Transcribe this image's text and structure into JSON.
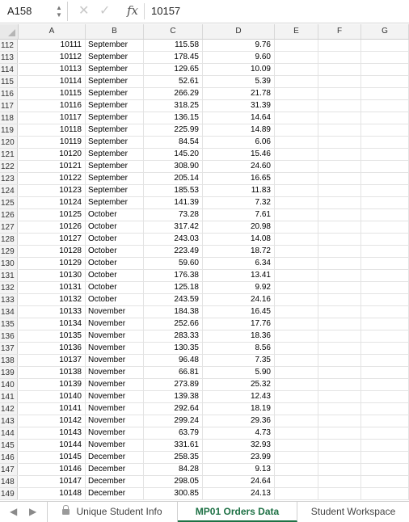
{
  "formula_bar": {
    "name_box": "A158",
    "cancel_icon": "close-icon",
    "enter_icon": "checkmark-icon",
    "fx_label": "fx",
    "value": "10157"
  },
  "columns": [
    "A",
    "B",
    "C",
    "D",
    "E",
    "F",
    "G"
  ],
  "rows": [
    {
      "n": "112",
      "a": "10111",
      "b": "September",
      "c": "115.58",
      "d": "9.76"
    },
    {
      "n": "113",
      "a": "10112",
      "b": "September",
      "c": "178.45",
      "d": "9.60"
    },
    {
      "n": "114",
      "a": "10113",
      "b": "September",
      "c": "129.65",
      "d": "10.09"
    },
    {
      "n": "115",
      "a": "10114",
      "b": "September",
      "c": "52.61",
      "d": "5.39"
    },
    {
      "n": "116",
      "a": "10115",
      "b": "September",
      "c": "266.29",
      "d": "21.78"
    },
    {
      "n": "117",
      "a": "10116",
      "b": "September",
      "c": "318.25",
      "d": "31.39"
    },
    {
      "n": "118",
      "a": "10117",
      "b": "September",
      "c": "136.15",
      "d": "14.64"
    },
    {
      "n": "119",
      "a": "10118",
      "b": "September",
      "c": "225.99",
      "d": "14.89"
    },
    {
      "n": "120",
      "a": "10119",
      "b": "September",
      "c": "84.54",
      "d": "6.06"
    },
    {
      "n": "121",
      "a": "10120",
      "b": "September",
      "c": "145.20",
      "d": "15.46"
    },
    {
      "n": "122",
      "a": "10121",
      "b": "September",
      "c": "308.90",
      "d": "24.60"
    },
    {
      "n": "123",
      "a": "10122",
      "b": "September",
      "c": "205.14",
      "d": "16.65"
    },
    {
      "n": "124",
      "a": "10123",
      "b": "September",
      "c": "185.53",
      "d": "11.83"
    },
    {
      "n": "125",
      "a": "10124",
      "b": "September",
      "c": "141.39",
      "d": "7.32"
    },
    {
      "n": "126",
      "a": "10125",
      "b": "October",
      "c": "73.28",
      "d": "7.61"
    },
    {
      "n": "127",
      "a": "10126",
      "b": "October",
      "c": "317.42",
      "d": "20.98"
    },
    {
      "n": "128",
      "a": "10127",
      "b": "October",
      "c": "243.03",
      "d": "14.08"
    },
    {
      "n": "129",
      "a": "10128",
      "b": "October",
      "c": "223.49",
      "d": "18.72"
    },
    {
      "n": "130",
      "a": "10129",
      "b": "October",
      "c": "59.60",
      "d": "6.34"
    },
    {
      "n": "131",
      "a": "10130",
      "b": "October",
      "c": "176.38",
      "d": "13.41"
    },
    {
      "n": "132",
      "a": "10131",
      "b": "October",
      "c": "125.18",
      "d": "9.92"
    },
    {
      "n": "133",
      "a": "10132",
      "b": "October",
      "c": "243.59",
      "d": "24.16"
    },
    {
      "n": "134",
      "a": "10133",
      "b": "November",
      "c": "184.38",
      "d": "16.45"
    },
    {
      "n": "135",
      "a": "10134",
      "b": "November",
      "c": "252.66",
      "d": "17.76"
    },
    {
      "n": "136",
      "a": "10135",
      "b": "November",
      "c": "283.33",
      "d": "18.36"
    },
    {
      "n": "137",
      "a": "10136",
      "b": "November",
      "c": "130.35",
      "d": "8.56"
    },
    {
      "n": "138",
      "a": "10137",
      "b": "November",
      "c": "96.48",
      "d": "7.35"
    },
    {
      "n": "139",
      "a": "10138",
      "b": "November",
      "c": "66.81",
      "d": "5.90"
    },
    {
      "n": "140",
      "a": "10139",
      "b": "November",
      "c": "273.89",
      "d": "25.32"
    },
    {
      "n": "141",
      "a": "10140",
      "b": "November",
      "c": "139.38",
      "d": "12.43"
    },
    {
      "n": "142",
      "a": "10141",
      "b": "November",
      "c": "292.64",
      "d": "18.19"
    },
    {
      "n": "143",
      "a": "10142",
      "b": "November",
      "c": "299.24",
      "d": "29.36"
    },
    {
      "n": "144",
      "a": "10143",
      "b": "November",
      "c": "63.79",
      "d": "4.73"
    },
    {
      "n": "145",
      "a": "10144",
      "b": "November",
      "c": "331.61",
      "d": "32.93"
    },
    {
      "n": "146",
      "a": "10145",
      "b": "December",
      "c": "258.35",
      "d": "23.99"
    },
    {
      "n": "147",
      "a": "10146",
      "b": "December",
      "c": "84.28",
      "d": "9.13"
    },
    {
      "n": "148",
      "a": "10147",
      "b": "December",
      "c": "298.05",
      "d": "24.64"
    },
    {
      "n": "149",
      "a": "10148",
      "b": "December",
      "c": "300.85",
      "d": "24.13"
    }
  ],
  "sheet_tabs": [
    {
      "label": "Unique Student Info",
      "locked": true,
      "active": false
    },
    {
      "label": "MP01 Orders Data",
      "locked": false,
      "active": true
    },
    {
      "label": "Student Workspace",
      "locked": false,
      "active": false
    }
  ],
  "colors": {
    "accent": "#1e7145",
    "gridline": "#e3e3e3",
    "header_bg": "#f3f3f3"
  }
}
